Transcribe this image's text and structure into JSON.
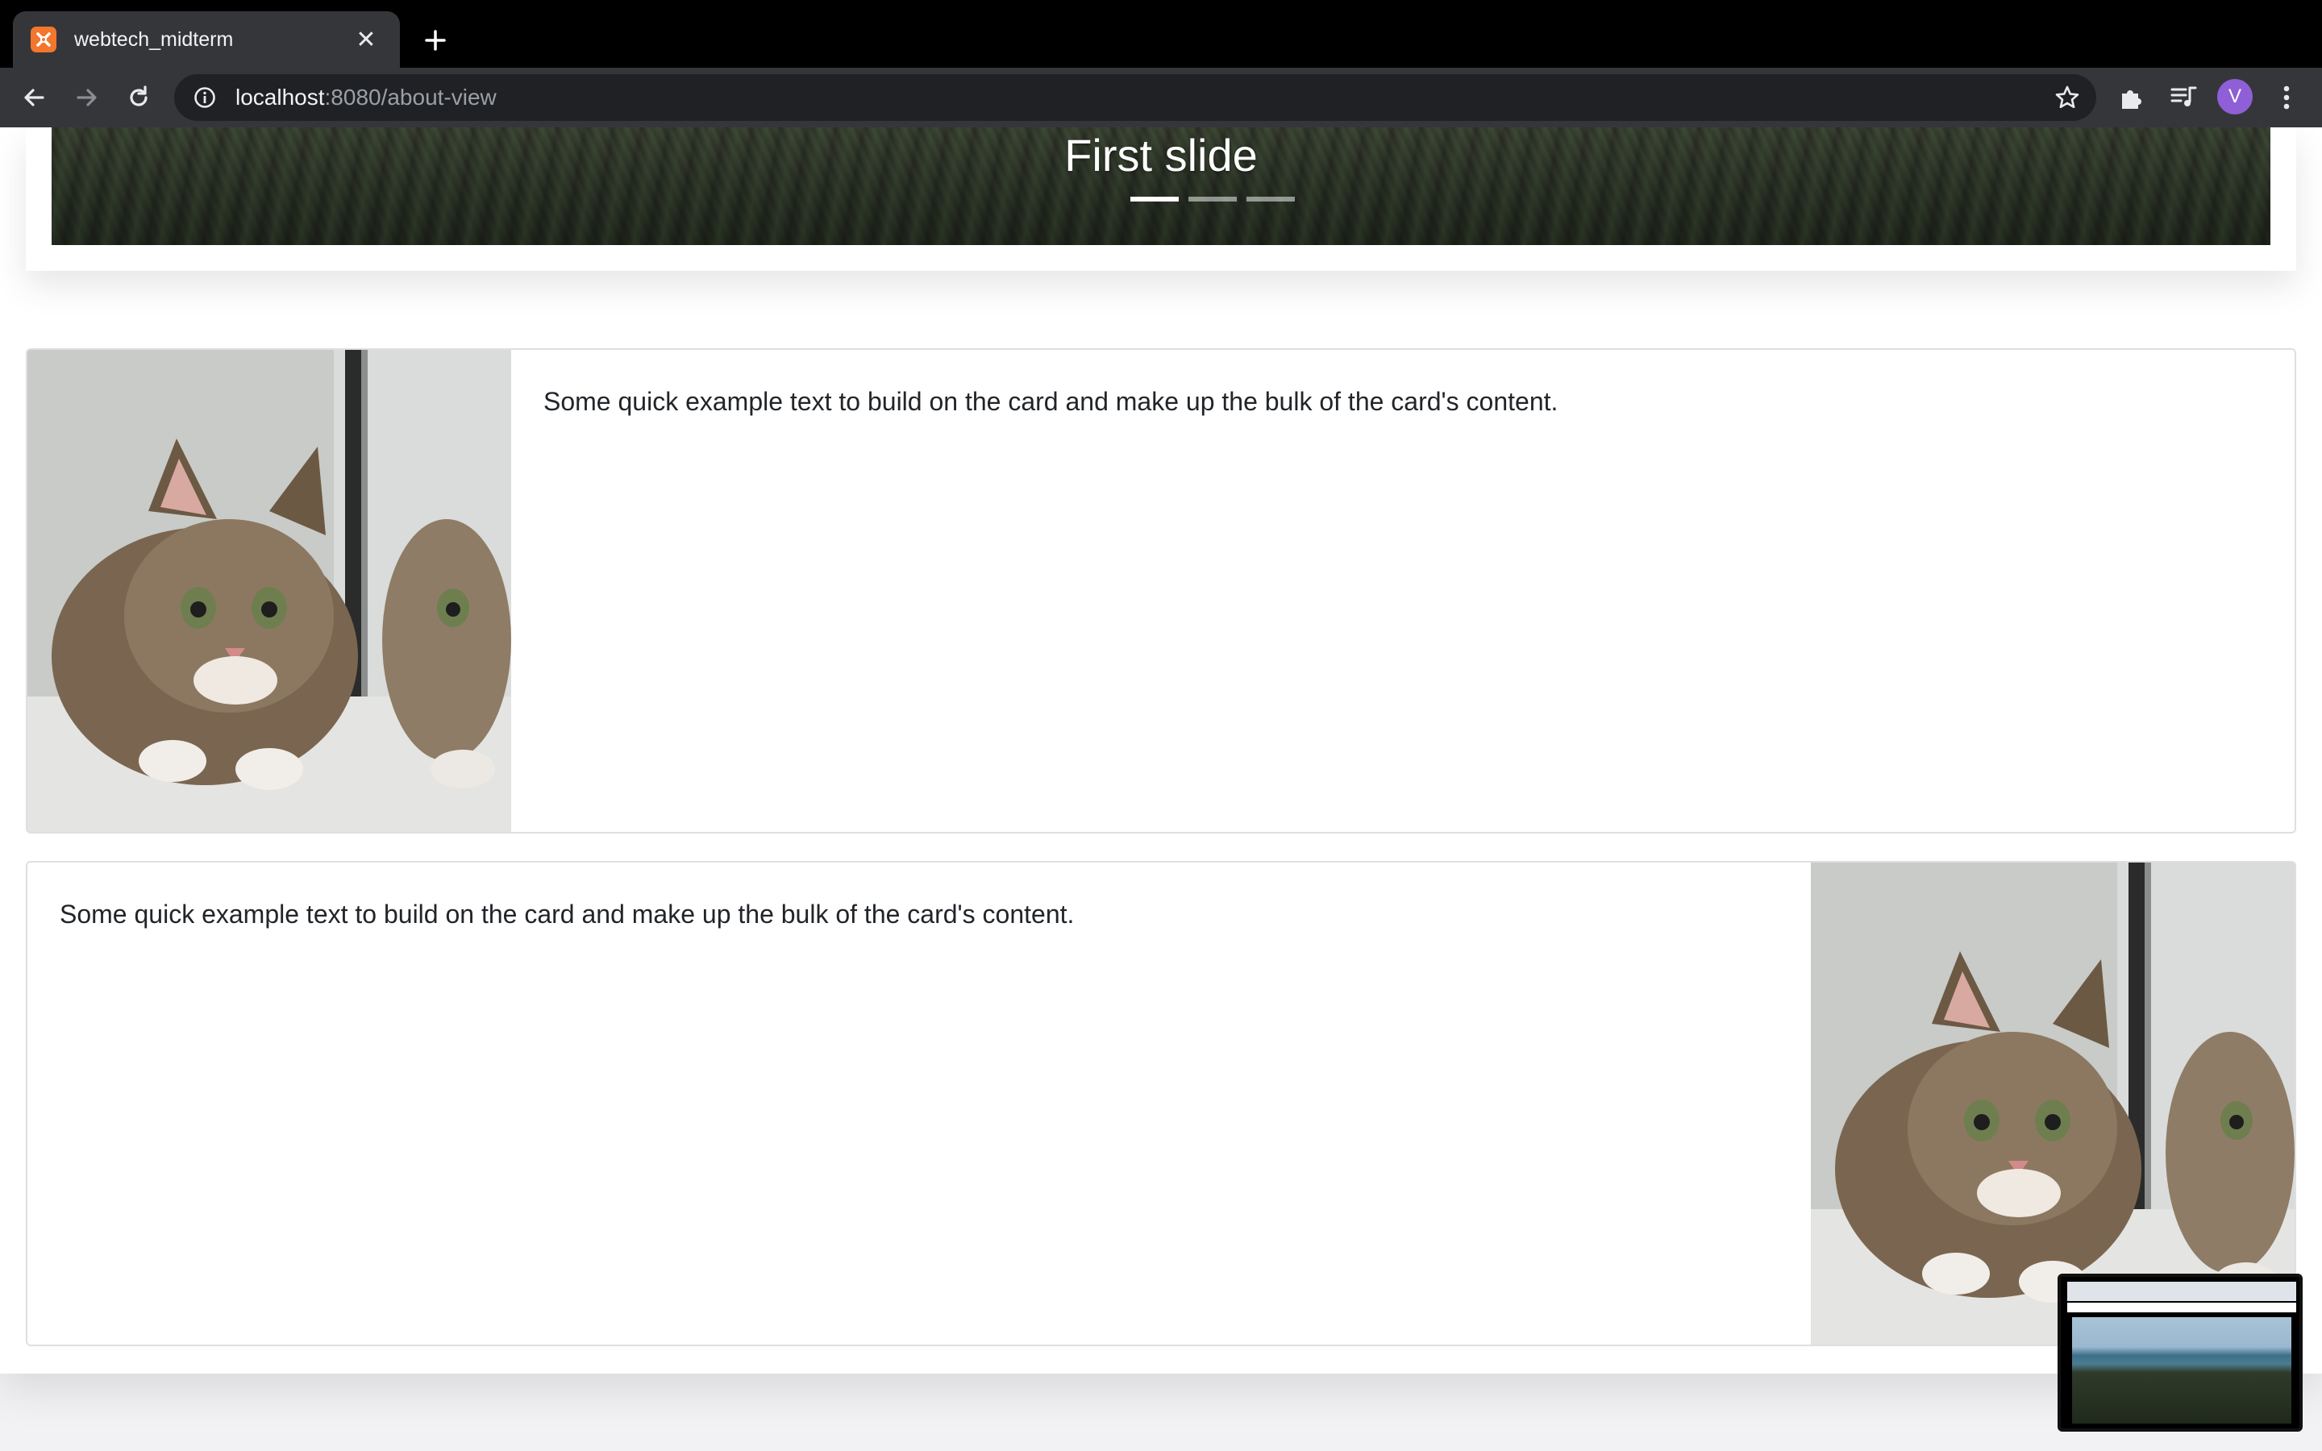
{
  "browser": {
    "tab_title": "webtech_midterm",
    "tab_close": "✕",
    "url_host": "localhost",
    "url_rest": ":8080/about-view",
    "profile_initial": "V"
  },
  "icons": {
    "favicon": "xampp-favicon-icon",
    "new_tab": "plus-icon",
    "back": "back-arrow-icon",
    "forward": "forward-arrow-icon",
    "reload": "reload-icon",
    "site_info": "info-icon",
    "bookmark": "star-icon",
    "extensions": "puzzle-icon",
    "media": "media-queue-icon",
    "menu": "kebab-menu-icon"
  },
  "carousel": {
    "caption": "First slide",
    "slide_count": 3,
    "active_index": 0
  },
  "cards": [
    {
      "text": "Some quick example text to build on the card and make up the bulk of the card's content.",
      "image_position": "left"
    },
    {
      "text": "Some quick example text to build on the card and make up the bulk of the card's content.",
      "image_position": "right"
    }
  ],
  "colors": {
    "browser_frame": "#000000",
    "toolbar": "#35363a",
    "omnibox": "#202124",
    "favicon": "#f2762e",
    "avatar": "#8e5fd6",
    "page_background": "#f2f2f4",
    "card_border": "#dfdfdf",
    "text": "#212529"
  }
}
